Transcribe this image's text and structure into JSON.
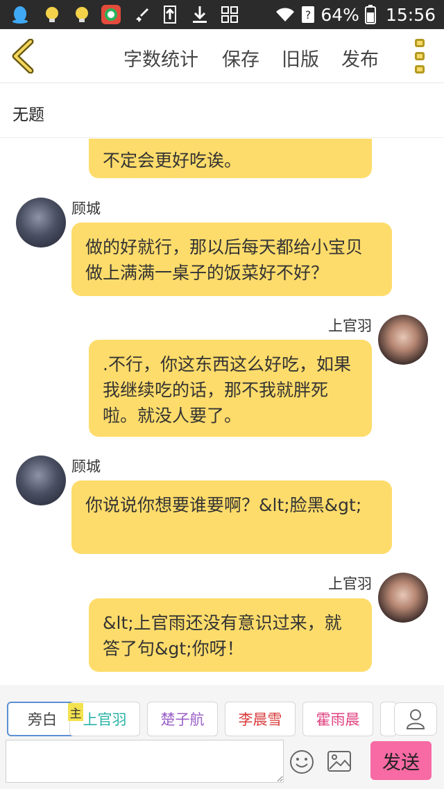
{
  "status_bar": {
    "battery": "64%",
    "time": "15:56",
    "notification_icons": [
      "qq-icon",
      "lightbulb-icon",
      "lightbulb-icon",
      "browser-icon",
      "rocket-icon",
      "upload-icon",
      "download-icon",
      "grid-icon"
    ]
  },
  "toolbar": {
    "word_count": "字数统计",
    "save": "保存",
    "old_version": "旧版",
    "publish": "发布"
  },
  "doc": {
    "title": "无题"
  },
  "messages": [
    {
      "speaker": "",
      "side": "right",
      "text": "不定会更好吃诶。"
    },
    {
      "speaker": "顾城",
      "side": "left",
      "text": "做的好就行，那以后每天都给小宝贝做上满满一桌子的饭菜好不好？"
    },
    {
      "speaker": "上官羽",
      "side": "right",
      "text": ".不行，你这东西这么好吃，如果我继续吃的话，那不我就胖死啦。就没人要了。"
    },
    {
      "speaker": "顾城",
      "side": "left",
      "text": "你说说你想要谁要啊？&lt;脸黑&gt;"
    },
    {
      "speaker": "上官羽",
      "side": "right",
      "text": "&lt;上官雨还没有意识过来，就答了句&gt;你呀！"
    }
  ],
  "roles": [
    {
      "label": "旁白",
      "color": "#444444"
    },
    {
      "label": "上官羽",
      "color": "#2bb3a8"
    },
    {
      "label": "楚子航",
      "color": "#9a5fc8"
    },
    {
      "label": "李晨雪",
      "color": "#d93b3b"
    },
    {
      "label": "霍雨晨",
      "color": "#e0407e"
    }
  ],
  "host_tag": "主",
  "composer": {
    "placeholder": "",
    "send": "发送"
  },
  "colors": {
    "bubble": "#fedc6b",
    "send": "#f76aa4",
    "accent": "#f7d96a"
  }
}
